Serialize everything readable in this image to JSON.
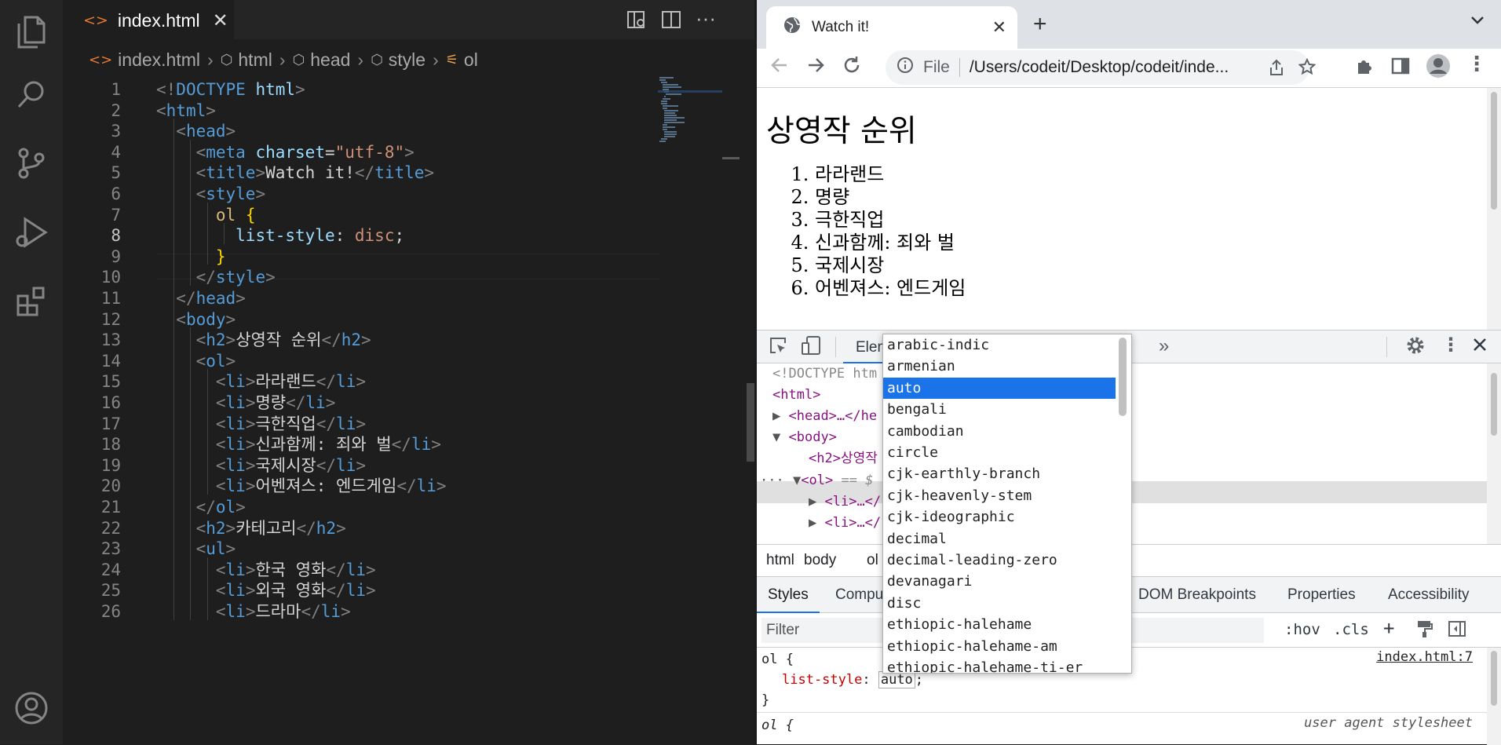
{
  "editor": {
    "tab": {
      "label": "index.html",
      "close": "✕"
    },
    "breadcrumb": [
      "index.html",
      "html",
      "head",
      "style",
      "ol"
    ],
    "lines": [
      {
        "n": "1",
        "parts": [
          [
            "t",
            "<!"
          ],
          [
            "tg",
            "DOCTYPE"
          ],
          [
            "tx",
            " "
          ],
          [
            "at",
            "html"
          ],
          [
            "t",
            ">"
          ]
        ]
      },
      {
        "n": "2",
        "parts": [
          [
            "t",
            "<"
          ],
          [
            "tg",
            "html"
          ],
          [
            "t",
            ">"
          ]
        ]
      },
      {
        "n": "3",
        "parts": [
          [
            "tx",
            "  "
          ],
          [
            "t",
            "<"
          ],
          [
            "tg",
            "head"
          ],
          [
            "t",
            ">"
          ]
        ]
      },
      {
        "n": "4",
        "parts": [
          [
            "tx",
            "    "
          ],
          [
            "t",
            "<"
          ],
          [
            "tg",
            "meta"
          ],
          [
            "tx",
            " "
          ],
          [
            "at",
            "charset"
          ],
          [
            "tx",
            "="
          ],
          [
            "st",
            "\"utf-8\""
          ],
          [
            "t",
            ">"
          ]
        ]
      },
      {
        "n": "5",
        "parts": [
          [
            "tx",
            "    "
          ],
          [
            "t",
            "<"
          ],
          [
            "tg",
            "title"
          ],
          [
            "t",
            ">"
          ],
          [
            "tx",
            "Watch it!"
          ],
          [
            "t",
            "</"
          ],
          [
            "tg",
            "title"
          ],
          [
            "t",
            ">"
          ]
        ]
      },
      {
        "n": "6",
        "parts": [
          [
            "tx",
            "    "
          ],
          [
            "t",
            "<"
          ],
          [
            "tg",
            "style"
          ],
          [
            "t",
            ">"
          ]
        ]
      },
      {
        "n": "7",
        "parts": [
          [
            "tx",
            "      "
          ],
          [
            "sel",
            "ol"
          ],
          [
            "tx",
            " "
          ],
          [
            "br",
            "{"
          ]
        ]
      },
      {
        "n": "8",
        "parts": [
          [
            "tx",
            "        "
          ],
          [
            "at",
            "list-style"
          ],
          [
            "tx",
            ": "
          ],
          [
            "st",
            "disc"
          ],
          [
            "tx",
            ";"
          ]
        ]
      },
      {
        "n": "9",
        "parts": [
          [
            "tx",
            "      "
          ],
          [
            "br",
            "}"
          ]
        ]
      },
      {
        "n": "10",
        "parts": [
          [
            "tx",
            "    "
          ],
          [
            "t",
            "</"
          ],
          [
            "tg",
            "style"
          ],
          [
            "t",
            ">"
          ]
        ]
      },
      {
        "n": "11",
        "parts": [
          [
            "tx",
            "  "
          ],
          [
            "t",
            "</"
          ],
          [
            "tg",
            "head"
          ],
          [
            "t",
            ">"
          ]
        ]
      },
      {
        "n": "12",
        "parts": [
          [
            "tx",
            "  "
          ],
          [
            "t",
            "<"
          ],
          [
            "tg",
            "body"
          ],
          [
            "t",
            ">"
          ]
        ]
      },
      {
        "n": "13",
        "parts": [
          [
            "tx",
            "    "
          ],
          [
            "t",
            "<"
          ],
          [
            "tg",
            "h2"
          ],
          [
            "t",
            ">"
          ],
          [
            "tx",
            "상영작 순위"
          ],
          [
            "t",
            "</"
          ],
          [
            "tg",
            "h2"
          ],
          [
            "t",
            ">"
          ]
        ]
      },
      {
        "n": "14",
        "parts": [
          [
            "tx",
            "    "
          ],
          [
            "t",
            "<"
          ],
          [
            "tg",
            "ol"
          ],
          [
            "t",
            ">"
          ]
        ]
      },
      {
        "n": "15",
        "parts": [
          [
            "tx",
            "      "
          ],
          [
            "t",
            "<"
          ],
          [
            "tg",
            "li"
          ],
          [
            "t",
            ">"
          ],
          [
            "tx",
            "라라랜드"
          ],
          [
            "t",
            "</"
          ],
          [
            "tg",
            "li"
          ],
          [
            "t",
            ">"
          ]
        ]
      },
      {
        "n": "16",
        "parts": [
          [
            "tx",
            "      "
          ],
          [
            "t",
            "<"
          ],
          [
            "tg",
            "li"
          ],
          [
            "t",
            ">"
          ],
          [
            "tx",
            "명량"
          ],
          [
            "t",
            "</"
          ],
          [
            "tg",
            "li"
          ],
          [
            "t",
            ">"
          ]
        ]
      },
      {
        "n": "17",
        "parts": [
          [
            "tx",
            "      "
          ],
          [
            "t",
            "<"
          ],
          [
            "tg",
            "li"
          ],
          [
            "t",
            ">"
          ],
          [
            "tx",
            "극한직업"
          ],
          [
            "t",
            "</"
          ],
          [
            "tg",
            "li"
          ],
          [
            "t",
            ">"
          ]
        ]
      },
      {
        "n": "18",
        "parts": [
          [
            "tx",
            "      "
          ],
          [
            "t",
            "<"
          ],
          [
            "tg",
            "li"
          ],
          [
            "t",
            ">"
          ],
          [
            "tx",
            "신과함께: 죄와 벌"
          ],
          [
            "t",
            "</"
          ],
          [
            "tg",
            "li"
          ],
          [
            "t",
            ">"
          ]
        ]
      },
      {
        "n": "19",
        "parts": [
          [
            "tx",
            "      "
          ],
          [
            "t",
            "<"
          ],
          [
            "tg",
            "li"
          ],
          [
            "t",
            ">"
          ],
          [
            "tx",
            "국제시장"
          ],
          [
            "t",
            "</"
          ],
          [
            "tg",
            "li"
          ],
          [
            "t",
            ">"
          ]
        ]
      },
      {
        "n": "20",
        "parts": [
          [
            "tx",
            "      "
          ],
          [
            "t",
            "<"
          ],
          [
            "tg",
            "li"
          ],
          [
            "t",
            ">"
          ],
          [
            "tx",
            "어벤져스: 엔드게임"
          ],
          [
            "t",
            "</"
          ],
          [
            "tg",
            "li"
          ],
          [
            "t",
            ">"
          ]
        ]
      },
      {
        "n": "21",
        "parts": [
          [
            "tx",
            "    "
          ],
          [
            "t",
            "</"
          ],
          [
            "tg",
            "ol"
          ],
          [
            "t",
            ">"
          ]
        ]
      },
      {
        "n": "22",
        "parts": [
          [
            "tx",
            "    "
          ],
          [
            "t",
            "<"
          ],
          [
            "tg",
            "h2"
          ],
          [
            "t",
            ">"
          ],
          [
            "tx",
            "카테고리"
          ],
          [
            "t",
            "</"
          ],
          [
            "tg",
            "h2"
          ],
          [
            "t",
            ">"
          ]
        ]
      },
      {
        "n": "23",
        "parts": [
          [
            "tx",
            "    "
          ],
          [
            "t",
            "<"
          ],
          [
            "tg",
            "ul"
          ],
          [
            "t",
            ">"
          ]
        ]
      },
      {
        "n": "24",
        "parts": [
          [
            "tx",
            "      "
          ],
          [
            "t",
            "<"
          ],
          [
            "tg",
            "li"
          ],
          [
            "t",
            ">"
          ],
          [
            "tx",
            "한국 영화"
          ],
          [
            "t",
            "</"
          ],
          [
            "tg",
            "li"
          ],
          [
            "t",
            ">"
          ]
        ]
      },
      {
        "n": "25",
        "parts": [
          [
            "tx",
            "      "
          ],
          [
            "t",
            "<"
          ],
          [
            "tg",
            "li"
          ],
          [
            "t",
            ">"
          ],
          [
            "tx",
            "외국 영화"
          ],
          [
            "t",
            "</"
          ],
          [
            "tg",
            "li"
          ],
          [
            "t",
            ">"
          ]
        ]
      },
      {
        "n": "26",
        "parts": [
          [
            "tx",
            "      "
          ],
          [
            "t",
            "<"
          ],
          [
            "tg",
            "li"
          ],
          [
            "t",
            ">"
          ],
          [
            "tx",
            "드라마"
          ],
          [
            "t",
            "</"
          ],
          [
            "tg",
            "li"
          ],
          [
            "t",
            ">"
          ]
        ]
      }
    ],
    "current_line": "8"
  },
  "browser": {
    "tab_title": "Watch it!",
    "tab_close": "✕",
    "new_tab": "+",
    "url_scheme": "File",
    "url": "/Users/codeit/Desktop/codeit/inde...",
    "page": {
      "heading": "상영작 순위",
      "items": [
        "라라랜드",
        "명량",
        "극한직업",
        "신과함께: 죄와 벌",
        "국제시장",
        "어벤져스: 엔드게임"
      ]
    }
  },
  "devtools": {
    "elements_tab": "Elem",
    "more_tabs": "»",
    "dom": {
      "doctype": "<!DOCTYPE htm",
      "html": "<html>",
      "head": "<head>…</he",
      "body": "<body>",
      "h2": "<h2>상영작",
      "ol": "<ol>",
      "ol_suffix": " == $",
      "li1": "<li>…</",
      "li2": "<li>…</",
      "dots": "···"
    },
    "crumbs": [
      "html",
      "body",
      "ol"
    ],
    "pane_tabs": {
      "styles": "Styles",
      "computed": "Compu",
      "dom_breakpoints": "DOM Breakpoints",
      "properties": "Properties",
      "accessibility": "Accessibility"
    },
    "filter_placeholder": "Filter",
    "hov": ":hov",
    "cls": ".cls",
    "plus": "+",
    "rule1": {
      "selector": "ol {",
      "prop": "list-style",
      "value": "auto",
      "close": "}",
      "source": "index.html:7"
    },
    "rule2": {
      "selector": "ol {",
      "source": "user agent stylesheet"
    },
    "autocomplete": [
      "arabic-indic",
      "armenian",
      "auto",
      "bengali",
      "cambodian",
      "circle",
      "cjk-earthly-branch",
      "cjk-heavenly-stem",
      "cjk-ideographic",
      "decimal",
      "decimal-leading-zero",
      "devanagari",
      "disc",
      "ethiopic-halehame",
      "ethiopic-halehame-am",
      "ethiopic-halehame-ti-er"
    ],
    "autocomplete_selected": "auto"
  }
}
